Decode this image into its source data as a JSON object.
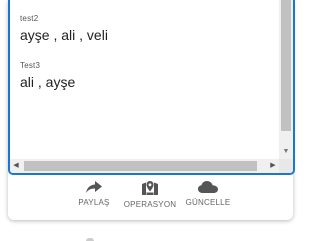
{
  "entries": [
    {
      "title": "test2",
      "value": "ayşe , ali , veli"
    },
    {
      "title": "Test3",
      "value": "ali , ayşe"
    }
  ],
  "actions": [
    {
      "label": "PAYLAŞ",
      "icon": "share-icon"
    },
    {
      "label": "OPERASYON",
      "icon": "map-marker-icon"
    },
    {
      "label": "GÜNCELLE",
      "icon": "cloud-icon"
    }
  ],
  "colors": {
    "focus_border": "#1976d2",
    "icon": "#555555",
    "label": "#666666"
  }
}
